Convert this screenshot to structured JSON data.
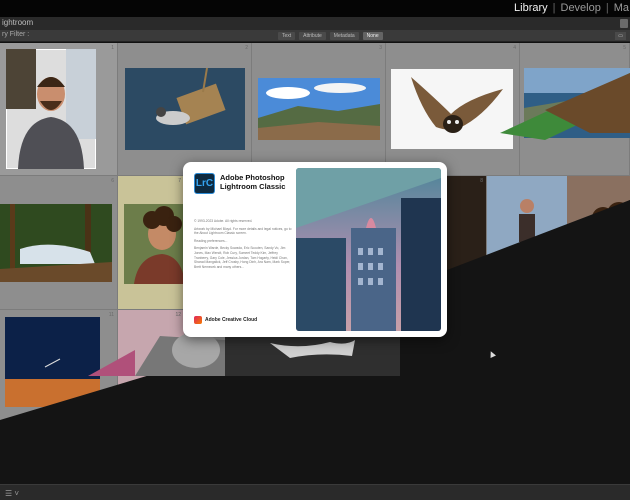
{
  "header": {
    "modules": [
      "Library",
      "Develop",
      "Ma"
    ],
    "active_module": "Library",
    "window_title": "ightroom"
  },
  "filter_bar": {
    "label": "ry Filter :",
    "tabs": [
      "Text",
      "Attribute",
      "Metadata",
      "None"
    ],
    "selected": "None"
  },
  "splash": {
    "logo_text": "LrC",
    "app_name_line1": "Adobe Photoshop",
    "app_name_line2": "Lightroom Classic",
    "copyright": "© 1993-2023 Adobe. All rights reserved.",
    "artwork_credit": "Artwork by Michael Bloyd. For more details and legal notices, go to the About Lightroom Classic screen.",
    "status": "Reading preferences...",
    "credits_text": "Benjamin Warde, Becky Sowada, Eric Scouten, Sandy Vo, Jim Jones, Max Wendt, Rob Cury, Sumeet Teddy Kim, Jeffrey Tranberry, Gary Cole, Jessica Jordan, Tom Hogarty, Heidi Chan, Sharad Mangalick, Jeff Crosby, Hong Dinh, Ara Nam, Mark Soper, Brett Nemecek and many others...",
    "cc_label": "Adobe Creative Cloud"
  },
  "grid_numbers": [
    "1",
    "2",
    "3",
    "4",
    "5",
    "6",
    "7",
    "8",
    "9",
    "10",
    "11",
    "12",
    "13"
  ],
  "colors": {
    "lrc_blue": "#2d8cd6",
    "grid_bg": "#8e8e8e",
    "dark_bg": "#111111"
  },
  "icons": {
    "bottom_left": "grid-view-icon",
    "cursor": "pointer-icon"
  }
}
